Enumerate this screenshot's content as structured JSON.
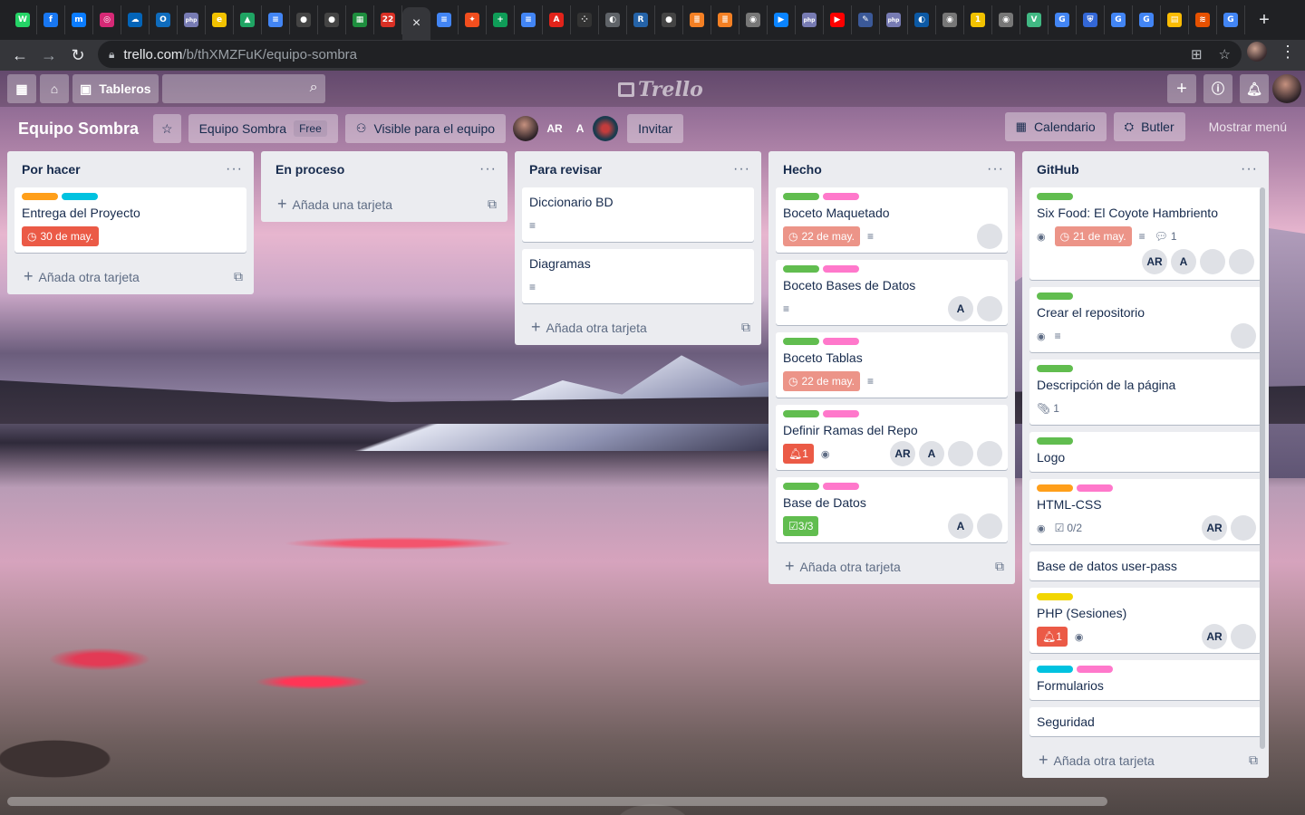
{
  "browser": {
    "active_tab_close": "×",
    "new_tab": "+",
    "tabs": [
      {
        "icon": "whatsapp-icon",
        "color": "#25d366",
        "glyph": "W"
      },
      {
        "icon": "facebook-icon",
        "color": "#1877f2",
        "glyph": "f"
      },
      {
        "icon": "messenger-icon",
        "color": "#0a7cff",
        "glyph": "m"
      },
      {
        "icon": "instagram-icon",
        "color": "#d62976",
        "glyph": "◎"
      },
      {
        "icon": "onedrive-icon",
        "color": "#0364b8",
        "glyph": "☁"
      },
      {
        "icon": "outlook-icon",
        "color": "#0f6cbd",
        "glyph": "O"
      },
      {
        "icon": "php-icon",
        "color": "#777bb3",
        "glyph": "php"
      },
      {
        "icon": "e-icon",
        "color": "#f2c200",
        "glyph": "e"
      },
      {
        "icon": "drive-icon",
        "color": "#1fa463",
        "glyph": "▲"
      },
      {
        "icon": "docs-icon",
        "color": "#4285f4",
        "glyph": "≡"
      },
      {
        "icon": "github-icon",
        "color": "#444",
        "glyph": "●"
      },
      {
        "icon": "github-icon",
        "color": "#444",
        "glyph": "●"
      },
      {
        "icon": "spreadsheet-icon",
        "color": "#1e8e3e",
        "glyph": "▦"
      },
      {
        "icon": "calendar-icon",
        "color": "#d93025",
        "glyph": "22"
      },
      {
        "icon": "docs-icon",
        "color": "#4285f4",
        "glyph": "≡"
      },
      {
        "icon": "figma-icon",
        "color": "#f24e1e",
        "glyph": "✦"
      },
      {
        "icon": "sheets-icon",
        "color": "#0f9d58",
        "glyph": "+"
      },
      {
        "icon": "docs-icon",
        "color": "#4285f4",
        "glyph": "≡"
      },
      {
        "icon": "acrobat-icon",
        "color": "#e2231a",
        "glyph": "A"
      },
      {
        "icon": "dots-icon",
        "color": "#333",
        "glyph": "⁘"
      },
      {
        "icon": "globe-icon",
        "color": "#5f6368",
        "glyph": "◐"
      },
      {
        "icon": "r-icon",
        "color": "#2563a8",
        "glyph": "R"
      },
      {
        "icon": "github-icon",
        "color": "#444",
        "glyph": "●"
      },
      {
        "icon": "stackoverflow-icon",
        "color": "#f48024",
        "glyph": "≣"
      },
      {
        "icon": "stackoverflow-icon",
        "color": "#f48024",
        "glyph": "≣"
      },
      {
        "icon": "elephant-icon",
        "color": "#777",
        "glyph": "◉"
      },
      {
        "icon": "play-icon",
        "color": "#0a84ff",
        "glyph": "▶"
      },
      {
        "icon": "php-icon",
        "color": "#777bb3",
        "glyph": "php"
      },
      {
        "icon": "youtube-icon",
        "color": "#ff0000",
        "glyph": "▶"
      },
      {
        "icon": "feather-icon",
        "color": "#3b5998",
        "glyph": "✎"
      },
      {
        "icon": "php-icon",
        "color": "#777bb3",
        "glyph": "php"
      },
      {
        "icon": "edge-icon",
        "color": "#0c59a4",
        "glyph": "◐"
      },
      {
        "icon": "elephant-icon",
        "color": "#777",
        "glyph": "◉"
      },
      {
        "icon": "one-icon",
        "color": "#f2c200",
        "glyph": "1"
      },
      {
        "icon": "elephant-icon",
        "color": "#777",
        "glyph": "◉"
      },
      {
        "icon": "vue-icon",
        "color": "#41b883",
        "glyph": "V"
      },
      {
        "icon": "google-icon",
        "color": "#4285f4",
        "glyph": "G"
      },
      {
        "icon": "shield-icon",
        "color": "#3367d6",
        "glyph": "⛨"
      },
      {
        "icon": "google-icon",
        "color": "#4285f4",
        "glyph": "G"
      },
      {
        "icon": "google-icon",
        "color": "#4285f4",
        "glyph": "G"
      },
      {
        "icon": "page-icon",
        "color": "#fbbc04",
        "glyph": "▤"
      },
      {
        "icon": "stack-icon",
        "color": "#e65100",
        "glyph": "≋"
      },
      {
        "icon": "google-icon",
        "color": "#4285f4",
        "glyph": "G"
      }
    ],
    "url_host": "trello.com",
    "url_path": "/b/thXMZFuK/equipo-sombra"
  },
  "header": {
    "boards_label": "Tableros",
    "logo_text": "Trello"
  },
  "board": {
    "title": "Equipo Sombra",
    "team_label": "Equipo Sombra",
    "plan_badge": "Free",
    "visibility_label": "Visible para el equipo",
    "member_initials_1": "AR",
    "member_initials_2": "A",
    "invite_label": "Invitar",
    "calendar_label": "Calendario",
    "butler_label": "Butler",
    "menu_label": "Mostrar menú"
  },
  "lists": [
    {
      "name": "Por hacer",
      "add_label": "Añada otra tarjeta",
      "cards": [
        {
          "title": "Entrega del Proyecto",
          "labels": [
            "#ff9f1a",
            "#00c2e0"
          ],
          "due": "30 de may."
        }
      ]
    },
    {
      "name": "En proceso",
      "add_label": "Añada una tarjeta",
      "cards": []
    },
    {
      "name": "Para revisar",
      "add_label": "Añada otra tarjeta",
      "cards": [
        {
          "title": "Diccionario BD",
          "labels": [],
          "desc": true
        },
        {
          "title": "Diagramas",
          "labels": [],
          "desc": true
        }
      ]
    },
    {
      "name": "Hecho",
      "add_label": "Añada otra tarjeta",
      "cards": [
        {
          "title": "Boceto Maquetado",
          "labels": [
            "#61bd4f",
            "#ff78cb"
          ],
          "due": "22 de may.",
          "due_faded": true,
          "desc": true,
          "members": [
            "phB"
          ]
        },
        {
          "title": "Boceto Bases de Datos",
          "labels": [
            "#61bd4f",
            "#ff78cb"
          ],
          "desc": true,
          "members": [
            "A",
            "phB"
          ]
        },
        {
          "title": "Boceto Tablas",
          "labels": [
            "#61bd4f",
            "#ff78cb"
          ],
          "due": "22 de may.",
          "due_faded": true,
          "desc": true
        },
        {
          "title": "Definir Ramas del Repo",
          "labels": [
            "#61bd4f",
            "#ff78cb"
          ],
          "notif": "1",
          "watch": true,
          "members": [
            "AR",
            "A",
            "phB",
            "phA"
          ]
        },
        {
          "title": "Base de Datos",
          "labels": [
            "#61bd4f",
            "#ff78cb"
          ],
          "checklist": "3/3",
          "checklist_done": true,
          "members": [
            "A",
            "phB"
          ]
        }
      ]
    },
    {
      "name": "GitHub",
      "add_label": "Añada otra tarjeta",
      "cards": [
        {
          "title": "Six Food: El Coyote Hambriento",
          "labels": [
            "#61bd4f"
          ],
          "watch": true,
          "due": "21 de may.",
          "due_faded": true,
          "desc": true,
          "comments": "1",
          "members": [
            "AR",
            "A",
            "phB",
            "phA"
          ],
          "members_row": true
        },
        {
          "title": "Crear el repositorio",
          "labels": [
            "#61bd4f"
          ],
          "watch": true,
          "desc": true,
          "members": [
            "phA"
          ]
        },
        {
          "title": "Descripción de la página",
          "labels": [
            "#61bd4f"
          ],
          "attachments": "1"
        },
        {
          "title": "Logo",
          "labels": [
            "#61bd4f"
          ]
        },
        {
          "title": "HTML-CSS",
          "labels": [
            "#ff9f1a",
            "#ff78cb"
          ],
          "watch": true,
          "checklist": "0/2",
          "members": [
            "AR",
            "phA"
          ]
        },
        {
          "title": "Base de datos user-pass",
          "labels": []
        },
        {
          "title": "PHP (Sesiones)",
          "labels": [
            "#f2d600"
          ],
          "notif": "1",
          "watch": true,
          "members": [
            "AR",
            "phA"
          ]
        },
        {
          "title": "Formularios",
          "labels": [
            "#00c2e0",
            "#ff78cb"
          ]
        },
        {
          "title": "Seguridad",
          "labels": []
        }
      ]
    }
  ]
}
